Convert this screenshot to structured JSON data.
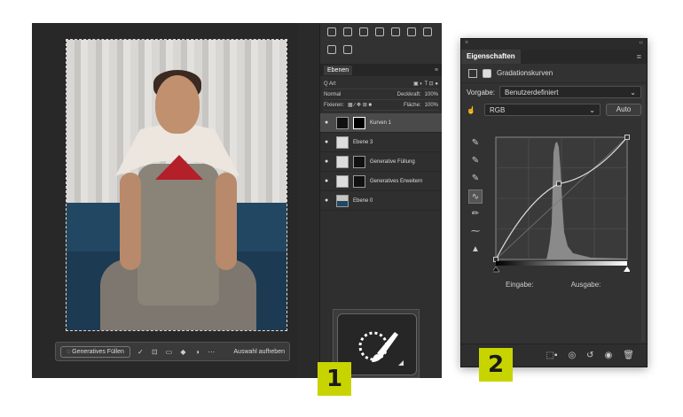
{
  "left_screenshot": {
    "context_bar": {
      "generative_fill_label": "Generatives Füllen",
      "deselect_label": "Auswahl aufheben",
      "icons": [
        "brush-icon",
        "transform-icon",
        "rectangle-icon",
        "fill-icon",
        "mask-icon",
        "more-icon"
      ]
    },
    "layers_panel": {
      "tab_label": "Ebenen",
      "filter_label": "Q Art",
      "blend_mode": "Normal",
      "opacity_label": "Deckkraft:",
      "opacity_value": "100%",
      "lock_label": "Fixieren:",
      "fill_label": "Fläche:",
      "fill_value": "100%",
      "layers": [
        {
          "name": "Kurven 1",
          "selected": true
        },
        {
          "name": "Ebene 3",
          "selected": false
        },
        {
          "name": "Generative Füllung",
          "selected": false
        },
        {
          "name": "Generatives Erweitern",
          "selected": false
        },
        {
          "name": "Ebene 0",
          "selected": false
        }
      ]
    },
    "zoom_tool_icon": "quick-selection-brush-icon",
    "badge": "1"
  },
  "right_screenshot": {
    "panel_title": "Eigenschaften",
    "adjustment_label": "Gradationskurven",
    "preset_label": "Vorgabe:",
    "preset_value": "Benutzerdefiniert",
    "channel_value": "RGB",
    "auto_label": "Auto",
    "input_label": "Eingabe:",
    "output_label": "Ausgabe:",
    "badge": "2",
    "curve_points": [
      {
        "input": 0,
        "output": 0
      },
      {
        "input": 0.48,
        "output": 0.62
      },
      {
        "input": 1,
        "output": 1
      }
    ]
  },
  "colors": {
    "badge_yellow": "#c8d400",
    "panel_dark": "#323232",
    "sofa_blue": "#1c3a52"
  }
}
